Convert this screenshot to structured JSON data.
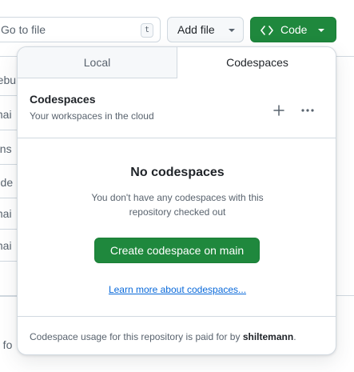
{
  "toolbar": {
    "goto_placeholder": "Go to file",
    "goto_shortcut": "t",
    "add_file_label": "Add file",
    "code_label": "Code"
  },
  "background_files": [
    "rebu",
    "mai",
    "ons",
    "r de",
    "mai",
    "mai",
    "",
    "a fo"
  ],
  "panel": {
    "tabs": [
      {
        "label": "Local",
        "active": false
      },
      {
        "label": "Codespaces",
        "active": true
      }
    ],
    "header": {
      "title": "Codespaces",
      "subtitle": "Your workspaces in the cloud"
    },
    "empty_state": {
      "title": "No codespaces",
      "description": "You don't have any codespaces with this repository checked out",
      "create_button": "Create codespace on main",
      "learn_more": "Learn more about codespaces..."
    },
    "footer": {
      "text": "Codespace usage for this repository is paid for by",
      "owner": "shiltemann",
      "end": "."
    }
  },
  "colors": {
    "primary_green": "#1f883d",
    "link_blue": "#0969da",
    "border": "#d1d9e0",
    "muted_text": "#59636e"
  },
  "icons": [
    "code-icon",
    "chevron-down-icon",
    "plus-icon",
    "kebab-horizontal-icon"
  ]
}
